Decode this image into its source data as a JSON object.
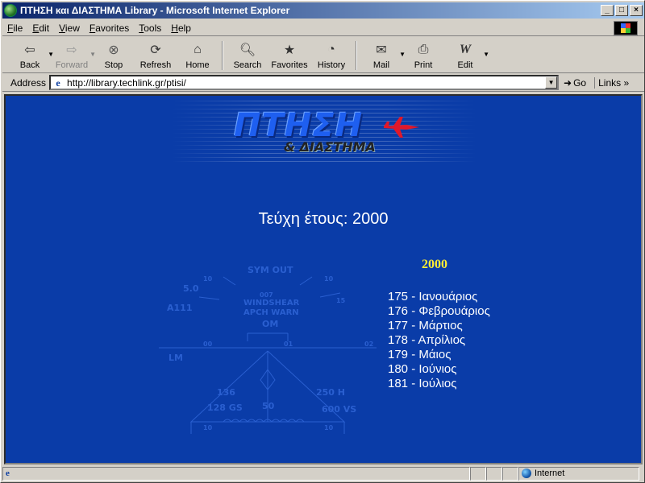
{
  "window": {
    "title": "ΠΤΗΣΗ και ΔΙΑΣΤΗΜΑ Library - Microsoft Internet Explorer"
  },
  "menu": [
    {
      "key": "F",
      "rest": "ile"
    },
    {
      "key": "E",
      "rest": "dit"
    },
    {
      "key": "V",
      "rest": "iew"
    },
    {
      "key": "F",
      "rest": "avorites"
    },
    {
      "key": "T",
      "rest": "ools"
    },
    {
      "key": "H",
      "rest": "elp"
    }
  ],
  "toolbar": {
    "back": "Back",
    "forward": "Forward",
    "stop": "Stop",
    "refresh": "Refresh",
    "home": "Home",
    "search": "Search",
    "favorites": "Favorites",
    "history": "History",
    "mail": "Mail",
    "print": "Print",
    "edit": "Edit"
  },
  "address": {
    "label": "Address",
    "url": "http://library.techlink.gr/ptisi/",
    "go": "Go",
    "links": "Links"
  },
  "page": {
    "logo_title": "ΠΤΗΣΗ",
    "logo_sub": "& ΔΙΑΣΤΗΜΑ",
    "heading": "Τεύχη έτους: 2000",
    "year": "2000",
    "issues": [
      "175 - Ιανουάριος",
      "176 - Φεβρουάριος",
      "177 - Μάρτιος",
      "178 - Απρίλιος",
      "179 - Μάιος",
      "180 - Ιούνιος",
      "181 - Ιούλιος"
    ],
    "hud": {
      "sym_out": "SYM OUT",
      "windshear": "WINDSHEAR",
      "apch_warn": "APCH WARN",
      "om": "OM",
      "val_50": "5.0",
      "a111": "A111",
      "lm": "LM",
      "n10a": "10",
      "n10b": "10",
      "n15": "15",
      "n007": "007",
      "n00": "00",
      "n01": "01",
      "n02": "02",
      "n136": "136",
      "n250h": "250 H",
      "n128gs": "128 GS",
      "n50": "50",
      "n600vs": "600 VS",
      "n10c": "10",
      "n10d": "10"
    }
  },
  "status": {
    "zone": "Internet"
  }
}
